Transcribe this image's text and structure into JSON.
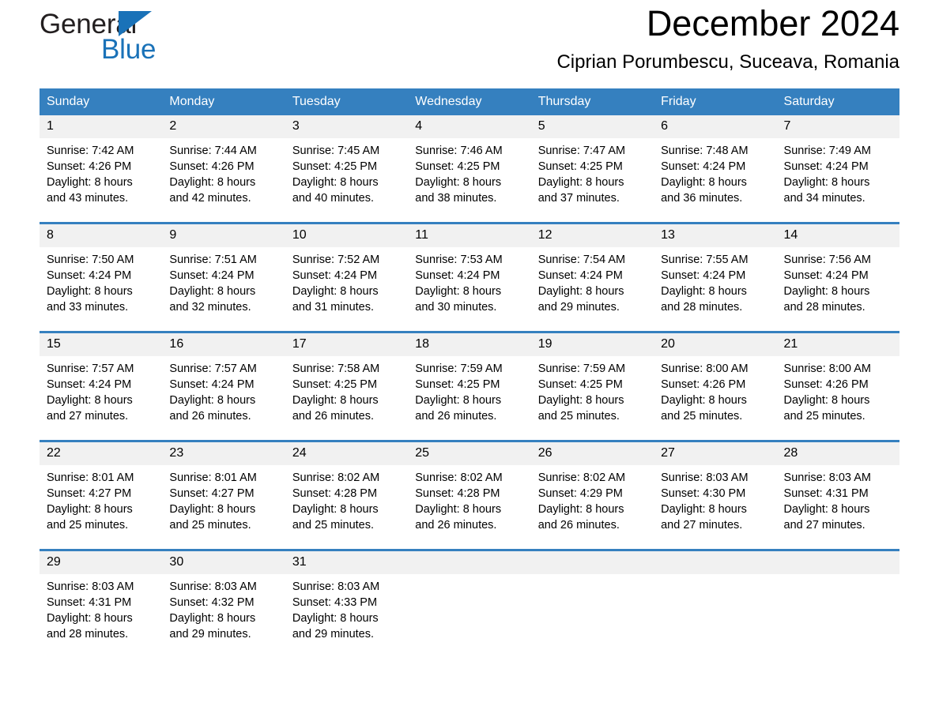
{
  "brand": {
    "name_part1": "General",
    "name_part2": "Blue",
    "logo_icon": "triangle-logo-icon",
    "accent_color": "#1a72b8"
  },
  "header": {
    "month_title": "December 2024",
    "location": "Ciprian Porumbescu, Suceava, Romania"
  },
  "calendar": {
    "header_background": "#3580bf",
    "daynum_background": "#f1f1f1",
    "weekday_headers": [
      "Sunday",
      "Monday",
      "Tuesday",
      "Wednesday",
      "Thursday",
      "Friday",
      "Saturday"
    ],
    "weeks": [
      [
        {
          "day": "1",
          "sunrise": "Sunrise: 7:42 AM",
          "sunset": "Sunset: 4:26 PM",
          "daylight_line1": "Daylight: 8 hours",
          "daylight_line2": "and 43 minutes."
        },
        {
          "day": "2",
          "sunrise": "Sunrise: 7:44 AM",
          "sunset": "Sunset: 4:26 PM",
          "daylight_line1": "Daylight: 8 hours",
          "daylight_line2": "and 42 minutes."
        },
        {
          "day": "3",
          "sunrise": "Sunrise: 7:45 AM",
          "sunset": "Sunset: 4:25 PM",
          "daylight_line1": "Daylight: 8 hours",
          "daylight_line2": "and 40 minutes."
        },
        {
          "day": "4",
          "sunrise": "Sunrise: 7:46 AM",
          "sunset": "Sunset: 4:25 PM",
          "daylight_line1": "Daylight: 8 hours",
          "daylight_line2": "and 38 minutes."
        },
        {
          "day": "5",
          "sunrise": "Sunrise: 7:47 AM",
          "sunset": "Sunset: 4:25 PM",
          "daylight_line1": "Daylight: 8 hours",
          "daylight_line2": "and 37 minutes."
        },
        {
          "day": "6",
          "sunrise": "Sunrise: 7:48 AM",
          "sunset": "Sunset: 4:24 PM",
          "daylight_line1": "Daylight: 8 hours",
          "daylight_line2": "and 36 minutes."
        },
        {
          "day": "7",
          "sunrise": "Sunrise: 7:49 AM",
          "sunset": "Sunset: 4:24 PM",
          "daylight_line1": "Daylight: 8 hours",
          "daylight_line2": "and 34 minutes."
        }
      ],
      [
        {
          "day": "8",
          "sunrise": "Sunrise: 7:50 AM",
          "sunset": "Sunset: 4:24 PM",
          "daylight_line1": "Daylight: 8 hours",
          "daylight_line2": "and 33 minutes."
        },
        {
          "day": "9",
          "sunrise": "Sunrise: 7:51 AM",
          "sunset": "Sunset: 4:24 PM",
          "daylight_line1": "Daylight: 8 hours",
          "daylight_line2": "and 32 minutes."
        },
        {
          "day": "10",
          "sunrise": "Sunrise: 7:52 AM",
          "sunset": "Sunset: 4:24 PM",
          "daylight_line1": "Daylight: 8 hours",
          "daylight_line2": "and 31 minutes."
        },
        {
          "day": "11",
          "sunrise": "Sunrise: 7:53 AM",
          "sunset": "Sunset: 4:24 PM",
          "daylight_line1": "Daylight: 8 hours",
          "daylight_line2": "and 30 minutes."
        },
        {
          "day": "12",
          "sunrise": "Sunrise: 7:54 AM",
          "sunset": "Sunset: 4:24 PM",
          "daylight_line1": "Daylight: 8 hours",
          "daylight_line2": "and 29 minutes."
        },
        {
          "day": "13",
          "sunrise": "Sunrise: 7:55 AM",
          "sunset": "Sunset: 4:24 PM",
          "daylight_line1": "Daylight: 8 hours",
          "daylight_line2": "and 28 minutes."
        },
        {
          "day": "14",
          "sunrise": "Sunrise: 7:56 AM",
          "sunset": "Sunset: 4:24 PM",
          "daylight_line1": "Daylight: 8 hours",
          "daylight_line2": "and 28 minutes."
        }
      ],
      [
        {
          "day": "15",
          "sunrise": "Sunrise: 7:57 AM",
          "sunset": "Sunset: 4:24 PM",
          "daylight_line1": "Daylight: 8 hours",
          "daylight_line2": "and 27 minutes."
        },
        {
          "day": "16",
          "sunrise": "Sunrise: 7:57 AM",
          "sunset": "Sunset: 4:24 PM",
          "daylight_line1": "Daylight: 8 hours",
          "daylight_line2": "and 26 minutes."
        },
        {
          "day": "17",
          "sunrise": "Sunrise: 7:58 AM",
          "sunset": "Sunset: 4:25 PM",
          "daylight_line1": "Daylight: 8 hours",
          "daylight_line2": "and 26 minutes."
        },
        {
          "day": "18",
          "sunrise": "Sunrise: 7:59 AM",
          "sunset": "Sunset: 4:25 PM",
          "daylight_line1": "Daylight: 8 hours",
          "daylight_line2": "and 26 minutes."
        },
        {
          "day": "19",
          "sunrise": "Sunrise: 7:59 AM",
          "sunset": "Sunset: 4:25 PM",
          "daylight_line1": "Daylight: 8 hours",
          "daylight_line2": "and 25 minutes."
        },
        {
          "day": "20",
          "sunrise": "Sunrise: 8:00 AM",
          "sunset": "Sunset: 4:26 PM",
          "daylight_line1": "Daylight: 8 hours",
          "daylight_line2": "and 25 minutes."
        },
        {
          "day": "21",
          "sunrise": "Sunrise: 8:00 AM",
          "sunset": "Sunset: 4:26 PM",
          "daylight_line1": "Daylight: 8 hours",
          "daylight_line2": "and 25 minutes."
        }
      ],
      [
        {
          "day": "22",
          "sunrise": "Sunrise: 8:01 AM",
          "sunset": "Sunset: 4:27 PM",
          "daylight_line1": "Daylight: 8 hours",
          "daylight_line2": "and 25 minutes."
        },
        {
          "day": "23",
          "sunrise": "Sunrise: 8:01 AM",
          "sunset": "Sunset: 4:27 PM",
          "daylight_line1": "Daylight: 8 hours",
          "daylight_line2": "and 25 minutes."
        },
        {
          "day": "24",
          "sunrise": "Sunrise: 8:02 AM",
          "sunset": "Sunset: 4:28 PM",
          "daylight_line1": "Daylight: 8 hours",
          "daylight_line2": "and 25 minutes."
        },
        {
          "day": "25",
          "sunrise": "Sunrise: 8:02 AM",
          "sunset": "Sunset: 4:28 PM",
          "daylight_line1": "Daylight: 8 hours",
          "daylight_line2": "and 26 minutes."
        },
        {
          "day": "26",
          "sunrise": "Sunrise: 8:02 AM",
          "sunset": "Sunset: 4:29 PM",
          "daylight_line1": "Daylight: 8 hours",
          "daylight_line2": "and 26 minutes."
        },
        {
          "day": "27",
          "sunrise": "Sunrise: 8:03 AM",
          "sunset": "Sunset: 4:30 PM",
          "daylight_line1": "Daylight: 8 hours",
          "daylight_line2": "and 27 minutes."
        },
        {
          "day": "28",
          "sunrise": "Sunrise: 8:03 AM",
          "sunset": "Sunset: 4:31 PM",
          "daylight_line1": "Daylight: 8 hours",
          "daylight_line2": "and 27 minutes."
        }
      ],
      [
        {
          "day": "29",
          "sunrise": "Sunrise: 8:03 AM",
          "sunset": "Sunset: 4:31 PM",
          "daylight_line1": "Daylight: 8 hours",
          "daylight_line2": "and 28 minutes."
        },
        {
          "day": "30",
          "sunrise": "Sunrise: 8:03 AM",
          "sunset": "Sunset: 4:32 PM",
          "daylight_line1": "Daylight: 8 hours",
          "daylight_line2": "and 29 minutes."
        },
        {
          "day": "31",
          "sunrise": "Sunrise: 8:03 AM",
          "sunset": "Sunset: 4:33 PM",
          "daylight_line1": "Daylight: 8 hours",
          "daylight_line2": "and 29 minutes."
        },
        {
          "day": "",
          "sunrise": "",
          "sunset": "",
          "daylight_line1": "",
          "daylight_line2": ""
        },
        {
          "day": "",
          "sunrise": "",
          "sunset": "",
          "daylight_line1": "",
          "daylight_line2": ""
        },
        {
          "day": "",
          "sunrise": "",
          "sunset": "",
          "daylight_line1": "",
          "daylight_line2": ""
        },
        {
          "day": "",
          "sunrise": "",
          "sunset": "",
          "daylight_line1": "",
          "daylight_line2": ""
        }
      ]
    ]
  }
}
